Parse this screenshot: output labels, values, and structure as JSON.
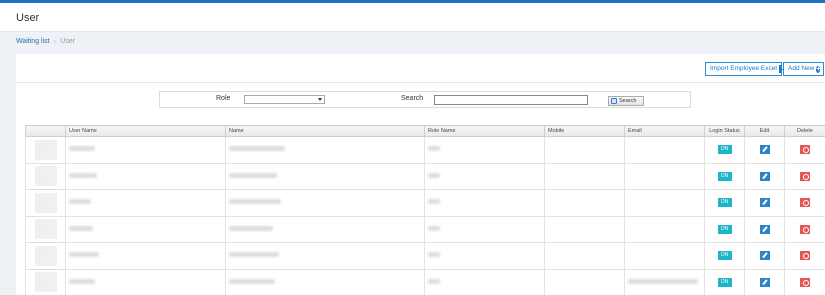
{
  "header": {
    "title": "User"
  },
  "breadcrumb": {
    "parent": "Waiting list",
    "separator": "»",
    "current": "User"
  },
  "actions": {
    "import_label": "Import Employee Excel",
    "add_label": "Add New"
  },
  "filters": {
    "role_label": "Role",
    "role_value": "",
    "search_label": "Search",
    "search_value": "",
    "search_button": "Search"
  },
  "table": {
    "columns": [
      "",
      "User Name",
      "Name",
      "Role Name",
      "Mobile",
      "Email",
      "Login Status",
      "Edit",
      "Delete"
    ],
    "rows": [
      {
        "status": "ON"
      },
      {
        "status": "ON"
      },
      {
        "status": "ON"
      },
      {
        "status": "ON"
      },
      {
        "status": "ON"
      },
      {
        "status": "ON"
      }
    ]
  },
  "colors": {
    "accent": "#1b73c2",
    "status_on": "#1fb5c9",
    "edit": "#2a86c8",
    "delete": "#e05a5a"
  }
}
